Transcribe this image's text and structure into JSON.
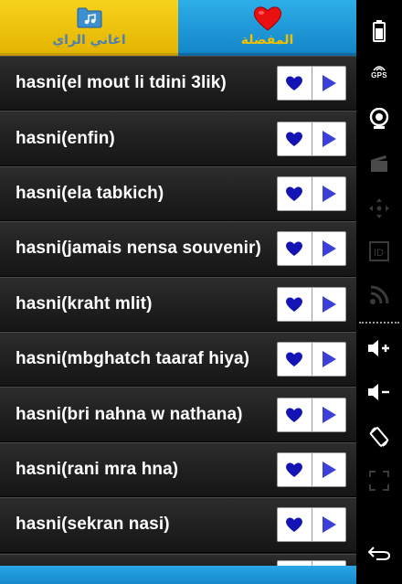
{
  "tabs": [
    {
      "label": "اغاني الراي",
      "icon": "folder-music-icon"
    },
    {
      "label": "المفضلة",
      "icon": "heart-icon"
    }
  ],
  "songs": [
    "hasni(el mout li tdini 3lik)",
    "hasni(enfin)",
    "hasni(ela tabkich)",
    "hasni(jamais nensa souvenir)",
    "hasni(kraht mlit)",
    "hasni(mbghatch taaraf hiya)",
    "hasni(bri nahna w nathana)",
    "hasni(rani mra hna)",
    "hasni(sekran nasi)"
  ],
  "system_bar": {
    "gps_label": "GPS",
    "icons": [
      "battery-icon",
      "gps-icon",
      "webcam-icon",
      "clapperboard-icon",
      "dpad-icon",
      "id-icon",
      "rss-icon",
      "volume-up-icon",
      "volume-down-icon",
      "rotate-icon",
      "fullscreen-icon",
      "back-icon"
    ]
  },
  "colors": {
    "tab_local": "#f0c300",
    "tab_fav": "#1e9bd8",
    "heart_button": "#1414b4",
    "play_button": "#3a40d8",
    "row_bg": "#222222"
  }
}
